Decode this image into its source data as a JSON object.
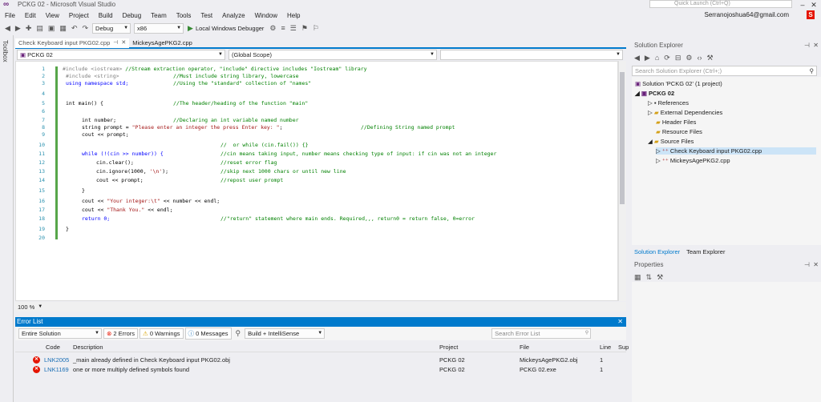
{
  "window": {
    "title": "PCKG 02 - Microsoft Visual Studio",
    "quick_launch": "Quick Launch (Ctrl+Q)",
    "user_email": "Serranojoshua64@gmail.com",
    "user_initial": "S"
  },
  "menu": [
    "File",
    "Edit",
    "View",
    "Project",
    "Build",
    "Debug",
    "Team",
    "Tools",
    "Test",
    "Analyze",
    "Window",
    "Help"
  ],
  "toolbar": {
    "config": "Debug",
    "platform": "x86",
    "run_label": "Local Windows Debugger"
  },
  "toolbox_label": "Toolbox",
  "editor": {
    "tabs": [
      {
        "label": "Check Keyboard input PKG02.cpp",
        "active": true
      },
      {
        "label": "MickeysAgePKG2.cpp",
        "active": false
      }
    ],
    "nav_project": "PCKG 02",
    "nav_scope": "(Global Scope)",
    "line_numbers": [
      "1",
      "2",
      "3",
      "4",
      "5",
      "6",
      "7",
      "8",
      "9",
      "10",
      "11",
      "12",
      "13",
      "14",
      "15",
      "16",
      "17",
      "18",
      "19",
      "20"
    ],
    "zoom": "100 %",
    "lines": {
      "l1a": "#include <iostream>",
      "l1b": " //Stream extraction operator, \"include\" directive includes \"Iostream\" library",
      "l2a": "#include <string>",
      "l2b": "//Must include string library, lowercase",
      "l3a": "using namespace std;",
      "l3b": "//Using the \"standard\" collection of \"names\"",
      "l5a": "int main() {",
      "l5b": "//The header/heading of the function \"main\"",
      "l7a": "int number;",
      "l7b": "//Declaring an int variable named number",
      "l8a": "string prompt = ",
      "l8b": "\"Please enter an integer the press Enter key: \"",
      "l8c": "//Defining String named prompt",
      "l9a": "cout << prompt;",
      "l10b": "//  or while (cin.fail()) {}",
      "l11a": "while (!(cin >> number)) {",
      "l11b": "//cin means taking input, number means checking type of input: if cin was not an integer",
      "l12a": "cin.clear();",
      "l12b": "//reset error flag",
      "l13a": "cin.ignore(1000, ",
      "l13s": "'\\n'",
      "l13c": ");",
      "l13b": "//skip next 1000 chars or until new line",
      "l14a": "cout << prompt;",
      "l14b": "//repost user prompt",
      "l15a": "}",
      "l16a": "cout << ",
      "l16s": "\"Your integer:\\t\"",
      "l16c": " << number << endl;",
      "l17a": "cout << ",
      "l17s": "\"Thank You.\"",
      "l17c": " << endl;",
      "l18a": "return 0;",
      "l18b": "//\"return\" statement where main ends. Required,,, return0 = return false, 0=error",
      "l19a": "}"
    }
  },
  "error_list": {
    "title": "Error List",
    "scope": "Entire Solution",
    "errors_chip": "2 Errors",
    "warnings_chip": "0 Warnings",
    "messages_chip": "0 Messages",
    "build_filter": "Build + IntelliSense",
    "search_placeholder": "Search Error List",
    "columns": [
      "Code",
      "Description",
      "Project",
      "File",
      "Line",
      "Sup"
    ],
    "rows": [
      {
        "code": "LNK2005",
        "desc": "_main already defined in Check Keyboard input PKG02.obj",
        "project": "PCKG 02",
        "file": "MickeysAgePKG2.obj",
        "line": "1"
      },
      {
        "code": "LNK1169",
        "desc": "one or more multiply defined symbols found",
        "project": "PCKG 02",
        "file": "PCKG 02.exe",
        "line": "1"
      }
    ]
  },
  "solution_explorer": {
    "title": "Solution Explorer",
    "search_placeholder": "Search Solution Explorer (Ctrl+;)",
    "solution": "Solution 'PCKG 02' (1 project)",
    "project": "PCKG 02",
    "items": [
      "References",
      "External Dependencies",
      "Header Files",
      "Resource Files",
      "Source Files"
    ],
    "files": [
      "Check Keyboard input PKG02.cpp",
      "MickeysAgePKG2.cpp"
    ],
    "tab_solution": "Solution Explorer",
    "tab_team": "Team Explorer"
  },
  "properties": {
    "title": "Properties"
  },
  "colors": {
    "accent": "#007acc",
    "error": "#e51400",
    "keyword": "#0000ff",
    "comment": "#008000",
    "string": "#a31515"
  }
}
